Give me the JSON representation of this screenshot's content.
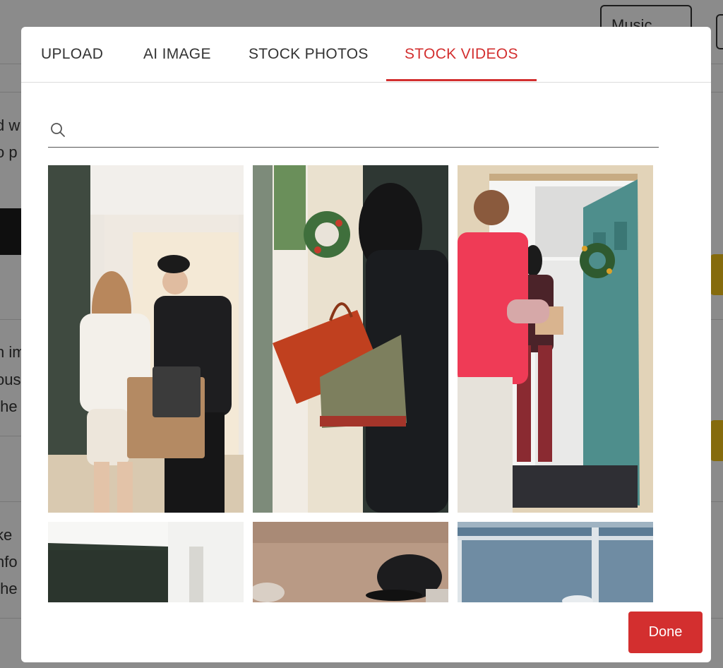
{
  "background": {
    "music_button": "Music",
    "snippets": [
      "d w",
      "o p",
      "n im",
      "ous",
      "the",
      "ke",
      "nfo",
      "the"
    ]
  },
  "tabs": [
    {
      "label": "UPLOAD",
      "active": false
    },
    {
      "label": "AI IMAGE",
      "active": false
    },
    {
      "label": "STOCK PHOTOS",
      "active": false
    },
    {
      "label": "STOCK VIDEOS",
      "active": true
    }
  ],
  "search": {
    "value": "",
    "placeholder": ""
  },
  "videos": [
    {
      "description": "woman receiving delivery from courier at door"
    },
    {
      "description": "woman with shopping bags entering home with wreath"
    },
    {
      "description": "man in red shirt at teal door with wreath"
    },
    {
      "description": "hallway interior"
    },
    {
      "description": "man in black cap"
    },
    {
      "description": "window view"
    }
  ],
  "footer": {
    "done_label": "Done"
  },
  "colors": {
    "accent": "#d32f2f",
    "tab_text": "#333333"
  }
}
